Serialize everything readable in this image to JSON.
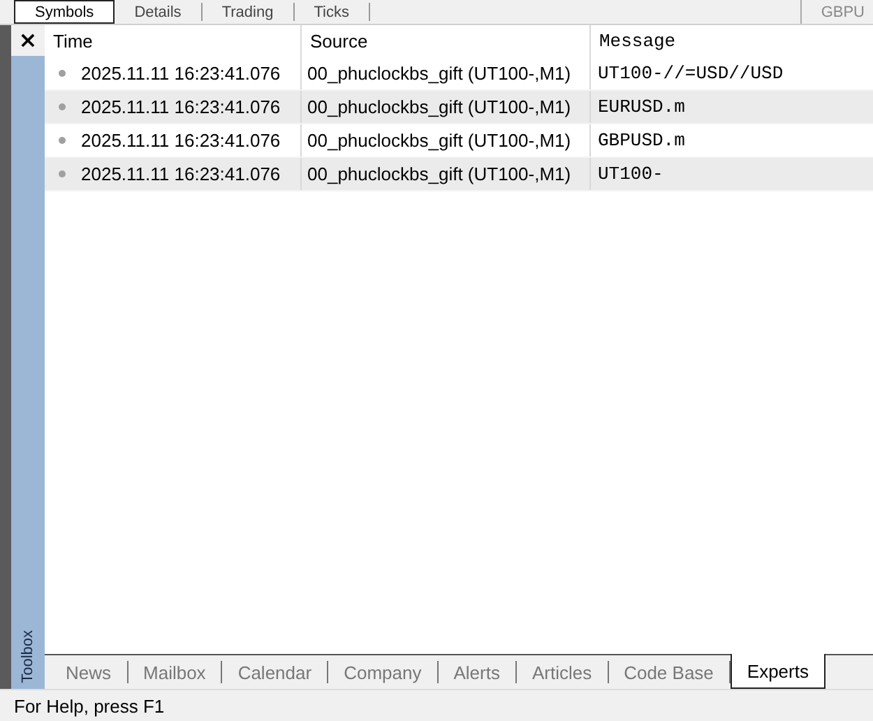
{
  "top_tabs": [
    {
      "label": "Symbols",
      "selected": true
    },
    {
      "label": "Details",
      "selected": false
    },
    {
      "label": "Trading",
      "selected": false
    },
    {
      "label": "Ticks",
      "selected": false
    }
  ],
  "top_right_label": "GBPU",
  "toolbox": {
    "close": "×",
    "title": "Toolbox"
  },
  "table": {
    "columns": [
      "Time",
      "Source",
      "Message"
    ],
    "rows": [
      {
        "time": "2025.11.11 16:23:41.076",
        "source": "00_phuclockbs_gift (UT100-,M1)",
        "message": "UT100-//=USD//USD"
      },
      {
        "time": "2025.11.11 16:23:41.076",
        "source": "00_phuclockbs_gift (UT100-,M1)",
        "message": "EURUSD.m"
      },
      {
        "time": "2025.11.11 16:23:41.076",
        "source": "00_phuclockbs_gift (UT100-,M1)",
        "message": "GBPUSD.m"
      },
      {
        "time": "2025.11.11 16:23:41.076",
        "source": "00_phuclockbs_gift (UT100-,M1)",
        "message": "UT100-"
      }
    ]
  },
  "bottom_tabs": [
    {
      "label": "News",
      "selected": false
    },
    {
      "label": "Mailbox",
      "selected": false
    },
    {
      "label": "Calendar",
      "selected": false
    },
    {
      "label": "Company",
      "selected": false
    },
    {
      "label": "Alerts",
      "selected": false
    },
    {
      "label": "Articles",
      "selected": false
    },
    {
      "label": "Code Base",
      "selected": false
    },
    {
      "label": "Experts",
      "selected": true
    }
  ],
  "status_bar": "For Help, press F1"
}
